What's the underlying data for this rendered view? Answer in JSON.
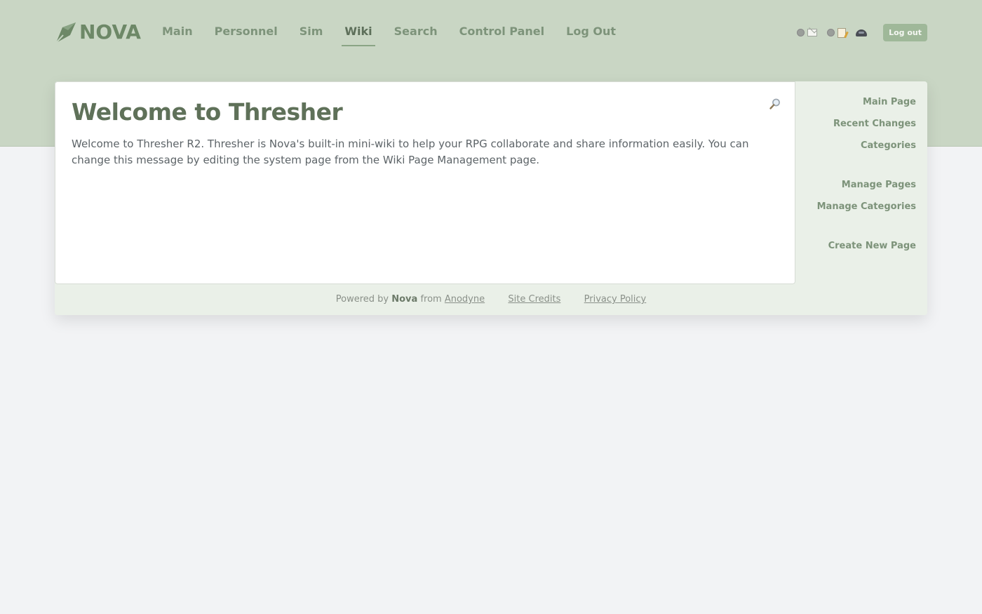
{
  "header": {
    "logo_text": "NOVA",
    "nav": [
      "Main",
      "Personnel",
      "Sim",
      "Wiki",
      "Search",
      "Control Panel",
      "Log Out"
    ],
    "active_nav": "Wiki",
    "tools": {
      "messages_icon": "envelope-icon",
      "posts_icon": "note-icon",
      "profile_icon": "helmet-icon"
    },
    "logout_label": "Log out"
  },
  "main": {
    "title": "Welcome to Thresher",
    "body": "Welcome to Thresher R2. Thresher is Nova's built-in mini-wiki to help your RPG collaborate and share information easily. You can change this message by editing the system page from the Wiki Page Management page.",
    "search_icon": "magnifier-icon"
  },
  "sidebar": {
    "links": [
      "Main Page",
      "Recent Changes",
      "Categories",
      "Manage Pages",
      "Manage Categories",
      "Create New Page"
    ]
  },
  "footer": {
    "powered_by": "Powered by",
    "product": "Nova",
    "from": "from",
    "company": "Anodyne",
    "site_credits": "Site Credits",
    "privacy_policy": "Privacy Policy"
  },
  "colors": {
    "accent": "#c9d6c4",
    "link": "#7d937a",
    "title": "#5f7159",
    "button": "#9fb899"
  }
}
